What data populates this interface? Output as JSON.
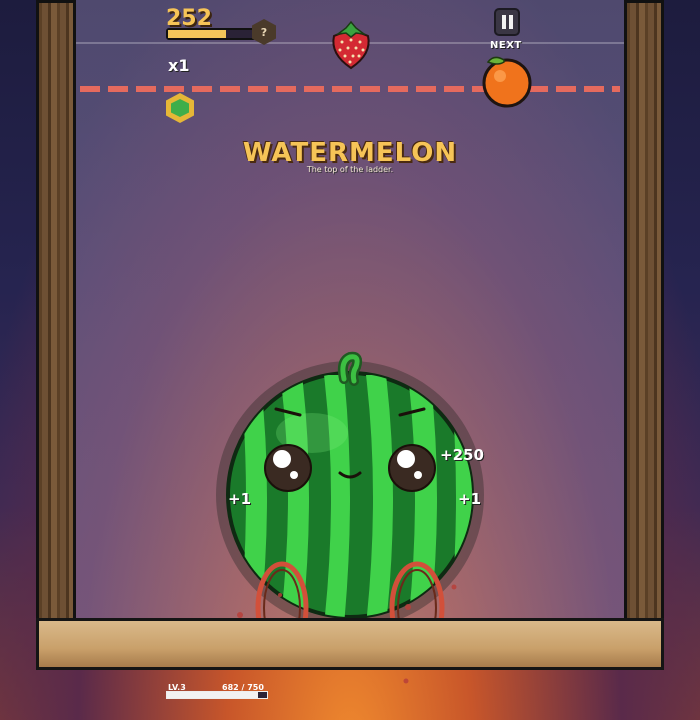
{
  "hud": {
    "score": "252",
    "score_progress": 0.68,
    "help_label": "?",
    "multiplier": "x1",
    "next_label": "NEXT"
  },
  "announcement": {
    "title": "WATERMELON",
    "subtitle": "The top of the ladder."
  },
  "popups": [
    {
      "text": "+250"
    },
    {
      "text": "+1"
    },
    {
      "text": "+1"
    }
  ],
  "level": {
    "label": "LV.3",
    "xp_text": "682 / 750",
    "xp_progress": 0.909
  },
  "fruits": {
    "held": "strawberry-icon",
    "next": "orange-icon",
    "main": "watermelon"
  }
}
